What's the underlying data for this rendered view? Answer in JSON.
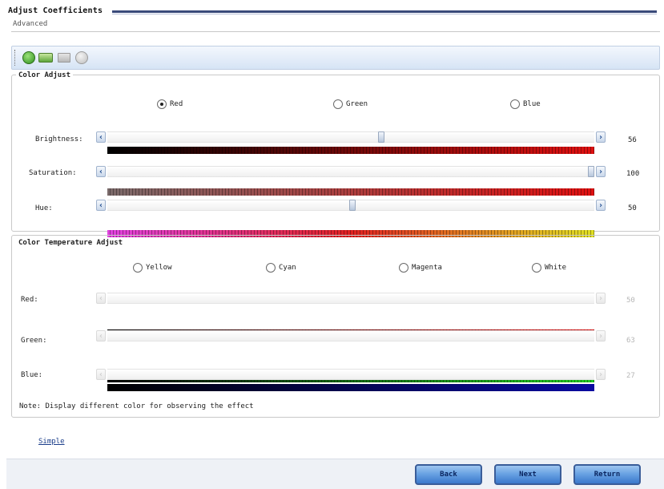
{
  "header": {
    "title": "Adjust Coefficients",
    "subtitle": "Advanced"
  },
  "toolbar": {
    "icons": [
      "go-icon",
      "open-folder-icon",
      "image-icon",
      "stop-icon"
    ]
  },
  "color_adjust": {
    "title": "Color Adjust",
    "radios": [
      {
        "label": "Red",
        "checked": true
      },
      {
        "label": "Green",
        "checked": false
      },
      {
        "label": "Blue",
        "checked": false
      }
    ],
    "rows": [
      {
        "label": "Brightness:",
        "value": "56",
        "position": 0.56,
        "gradient": [
          "#000000",
          "#e01010"
        ]
      },
      {
        "label": "Saturation:",
        "value": "100",
        "position": 1.0,
        "gradient": [
          "#7a6a6a",
          "#e01010"
        ]
      },
      {
        "label": "Hue:",
        "value": "50",
        "position": 0.5,
        "gradient": [
          "#e040e0",
          "#e02020",
          "#e0e020"
        ]
      }
    ]
  },
  "temperature_adjust": {
    "title": "Color Temperature Adjust",
    "radios": [
      {
        "label": "Yellow",
        "checked": false
      },
      {
        "label": "Cyan",
        "checked": false
      },
      {
        "label": "Magenta",
        "checked": false
      },
      {
        "label": "White",
        "checked": false
      }
    ],
    "rows": [
      {
        "label": "Red:",
        "value": "50",
        "gradient": [
          "#000000",
          "#e01010"
        ]
      },
      {
        "label": "Green:",
        "value": "63",
        "gradient": [
          "#000000",
          "#22cc22"
        ]
      },
      {
        "label": "Blue:",
        "value": "27",
        "gradient": [
          "#000000",
          "#0a0aa0"
        ]
      }
    ]
  },
  "note": "Note: Display different color for observing the effect",
  "simple_link": "Simple",
  "buttons": {
    "back": "Back",
    "next": "Next",
    "return": "Return"
  }
}
